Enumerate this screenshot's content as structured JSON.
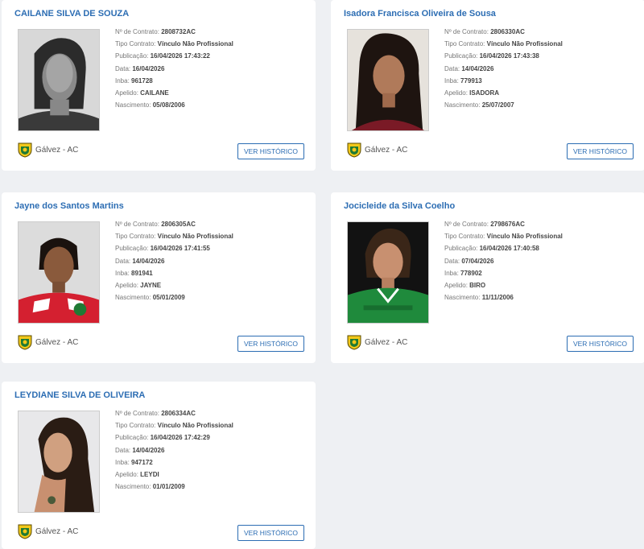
{
  "labels": {
    "contract_no": "Nº de Contrato:",
    "contract_type": "Tipo Contrato:",
    "publication": "Publicação:",
    "date": "Data:",
    "inba": "Inba:",
    "nickname": "Apelido:",
    "birth": "Nascimento:"
  },
  "button_label": "VER HISTÓRICO",
  "athletes": [
    {
      "name": "CAILANE SILVA DE SOUZA",
      "contract_no": "2808732AC",
      "contract_type": "Vínculo Não Profissional",
      "publication": "16/04/2026 17:43:22",
      "date": "16/04/2026",
      "inba": "961728",
      "nickname": "CAILANE",
      "birth": "05/08/2006",
      "club": "Gálvez - AC"
    },
    {
      "name": "Isadora Francisca Oliveira de Sousa",
      "contract_no": "2806330AC",
      "contract_type": "Vínculo Não Profissional",
      "publication": "16/04/2026 17:43:38",
      "date": "14/04/2026",
      "inba": "779913",
      "nickname": "ISADORA",
      "birth": "25/07/2007",
      "club": "Gálvez - AC"
    },
    {
      "name": "Jayne dos Santos Martins",
      "contract_no": "2806305AC",
      "contract_type": "Vínculo Não Profissional",
      "publication": "16/04/2026 17:41:55",
      "date": "14/04/2026",
      "inba": "891941",
      "nickname": "JAYNE",
      "birth": "05/01/2009",
      "club": "Gálvez - AC"
    },
    {
      "name": "Jocicleide da Silva Coelho",
      "contract_no": "2798676AC",
      "contract_type": "Vínculo Não Profissional",
      "publication": "16/04/2026 17:40:58",
      "date": "07/04/2026",
      "inba": "778902",
      "nickname": "BIRO",
      "birth": "11/11/2006",
      "club": "Gálvez - AC"
    },
    {
      "name": "LEYDIANE SILVA DE OLIVEIRA",
      "contract_no": "2806334AC",
      "contract_type": "Vínculo Não Profissional",
      "publication": "16/04/2026 17:42:29",
      "date": "14/04/2026",
      "inba": "947172",
      "nickname": "LEYDI",
      "birth": "01/01/2009",
      "club": "Gálvez - AC"
    }
  ],
  "colors": {
    "accent": "#2c6db3",
    "background": "#eef0f3",
    "card": "#ffffff"
  },
  "icons": {
    "club_crest": "galvez-crest-icon"
  }
}
